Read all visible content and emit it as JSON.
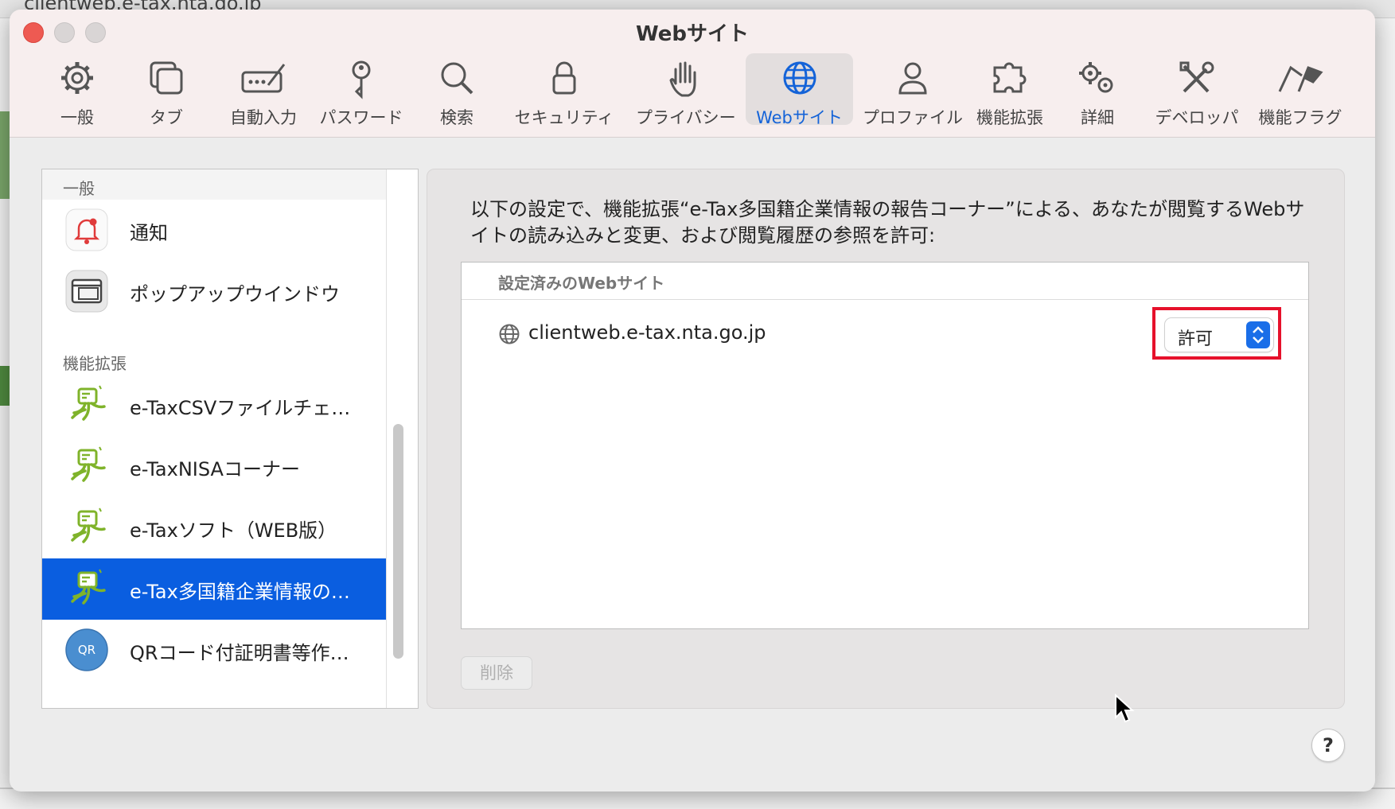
{
  "background": {
    "url": "clientweb.e-tax.nta.go.jp"
  },
  "window": {
    "title": "Webサイト"
  },
  "toolbar": {
    "items": [
      {
        "label": "一般",
        "icon": "gear-icon"
      },
      {
        "label": "タブ",
        "icon": "tabs-icon"
      },
      {
        "label": "自動入力",
        "icon": "autofill-icon"
      },
      {
        "label": "パスワード",
        "icon": "key-icon"
      },
      {
        "label": "検索",
        "icon": "search-icon"
      },
      {
        "label": "セキュリティ",
        "icon": "lock-icon"
      },
      {
        "label": "プライバシー",
        "icon": "hand-icon"
      },
      {
        "label": "Webサイト",
        "icon": "globe-icon",
        "active": true
      },
      {
        "label": "プロファイル",
        "icon": "person-icon"
      },
      {
        "label": "機能拡張",
        "icon": "puzzle-icon"
      },
      {
        "label": "詳細",
        "icon": "gears-icon"
      },
      {
        "label": "デベロッパ",
        "icon": "tools-icon"
      },
      {
        "label": "機能フラグ",
        "icon": "flags-icon"
      }
    ]
  },
  "sidebar": {
    "general_header": "一般",
    "general_items": [
      {
        "label": "通知",
        "icon": "bell-icon"
      },
      {
        "label": "ポップアップウインドウ",
        "icon": "popup-window-icon"
      }
    ],
    "extensions_header": "機能拡張",
    "extension_items": [
      {
        "label": "e-TaxCSVファイルチェ…",
        "icon": "etax-extension-icon"
      },
      {
        "label": "e-TaxNISAコーナー",
        "icon": "etax-extension-icon"
      },
      {
        "label": "e-Taxソフト（WEB版）",
        "icon": "etax-extension-icon"
      },
      {
        "label": "e-Tax多国籍企業情報の…",
        "icon": "etax-extension-icon",
        "selected": true
      },
      {
        "label": "QRコード付証明書等作…",
        "icon": "qr-icon",
        "icon_text": "QR"
      }
    ]
  },
  "main": {
    "description": "以下の設定で、機能拡張“e-Tax多国籍企業情報の報告コーナー”による、あなたが閲覧するWebサイトの読み込みと変更、および閲覧履歴の参照を許可:",
    "sites_header": "設定済みのWebサイト",
    "sites": [
      {
        "domain": "clientweb.e-tax.nta.go.jp",
        "permission": "許可"
      }
    ],
    "delete_label": "削除",
    "help_label": "?"
  },
  "colors": {
    "accent": "#0a5ee0",
    "highlight": "#e6112b",
    "close": "#ee5a52"
  }
}
